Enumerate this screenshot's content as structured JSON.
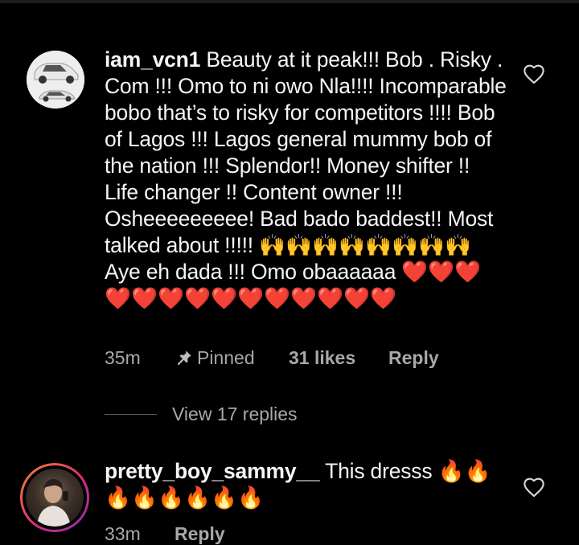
{
  "comments": [
    {
      "username": "iam_vcn1",
      "body": " Beauty at it peak!!! Bob . Risky . Com !!! Omo to ni owo Nla!!!! Incomparable bobo that’s to risky for competitors !!!! Bob of Lagos !!! Lagos general mummy bob of the nation !!! Splendor!! Money shifter !! Life changer !! Content owner !!! Osheeeeeeeee! Bad bado baddest!! Most talked about !!!!! ",
      "emoji_1": "🙌🙌🙌🙌🙌🙌🙌🙌",
      "middle_text": " Aye eh dada !!! Omo obaaaaaa ",
      "emoji_2": "❤️❤️❤️❤️❤️❤️❤️❤️❤️❤️❤️❤️❤️❤️",
      "time": "35m",
      "pinned_label": "Pinned",
      "likes": "31 likes",
      "reply_label": "Reply",
      "view_replies": "View 17 replies",
      "avatar_icon": "car-avatar"
    },
    {
      "username": "pretty_boy_sammy__",
      "body": " This dresss ",
      "emoji_1": "🔥🔥🔥🔥🔥🔥🔥🔥",
      "time": "33m",
      "reply_label": "Reply",
      "avatar_icon": "profile-photo-avatar"
    }
  ],
  "icons": {
    "like": "heart-outline-icon",
    "pin": "pin-icon"
  },
  "colors": {
    "background": "#000000",
    "text": "#f5f5f5",
    "muted": "#a8a8a8",
    "story_ring_start": "#f58529",
    "story_ring_end": "#8134af"
  }
}
